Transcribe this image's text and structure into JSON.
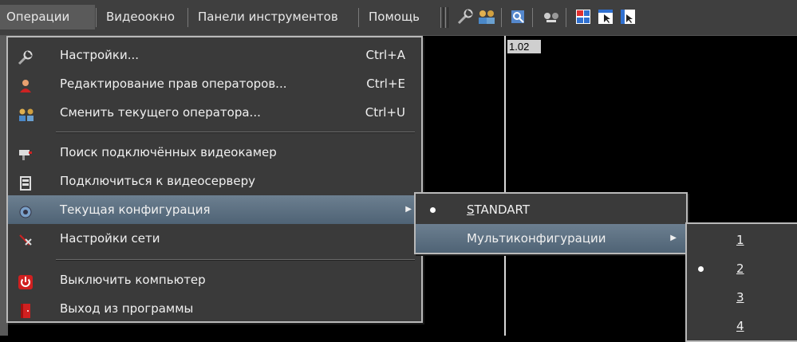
{
  "menubar": {
    "items": [
      {
        "label": "Операции"
      },
      {
        "label": "Видеоокно"
      },
      {
        "label": "Панели инструментов"
      },
      {
        "label": "Помощь"
      }
    ],
    "toolbar_icons": [
      "settings-wrench-icon",
      "switch-operator-icon",
      "search-camera-icon",
      "network-icon",
      "layout-grid-icon",
      "window-cursor-icon",
      "window-select-icon"
    ]
  },
  "video": {
    "channel_label": "1.02"
  },
  "operations_menu": {
    "items": [
      {
        "label": "Настройки...",
        "shortcut": "Ctrl+A",
        "icon": "wrench-icon"
      },
      {
        "label": "Редактирование прав операторов...",
        "shortcut": "Ctrl+E",
        "icon": "user-rights-icon"
      },
      {
        "label": "Сменить текущего оператора...",
        "shortcut": "Ctrl+U",
        "icon": "switch-operator-icon"
      },
      {
        "label": "Поиск подключённых видеокамер",
        "shortcut": "",
        "icon": "camera-search-icon"
      },
      {
        "label": "Подключиться к видеосерверу",
        "shortcut": "",
        "icon": "server-connect-icon"
      },
      {
        "label": "Текущая конфигурация",
        "shortcut": "",
        "icon": "config-gear-icon"
      },
      {
        "label": "Настройки сети",
        "shortcut": "",
        "icon": "network-settings-icon"
      },
      {
        "label": "Выключить компьютер",
        "shortcut": "",
        "icon": "power-icon"
      },
      {
        "label": "Выход из программы",
        "shortcut": "",
        "icon": "exit-door-icon"
      }
    ]
  },
  "config_submenu": {
    "items": [
      {
        "label_first": "S",
        "label_rest": "TANDART"
      },
      {
        "label": "Мультиконфигурации"
      }
    ]
  },
  "multi_submenu": {
    "items": [
      {
        "label": "1"
      },
      {
        "label": "2"
      },
      {
        "label": "3"
      },
      {
        "label": "4"
      }
    ]
  },
  "colors": {
    "menubar_bg": "#3f3f3f",
    "menu_bg": "#3a3a3a",
    "highlight": "#5a6e80"
  }
}
